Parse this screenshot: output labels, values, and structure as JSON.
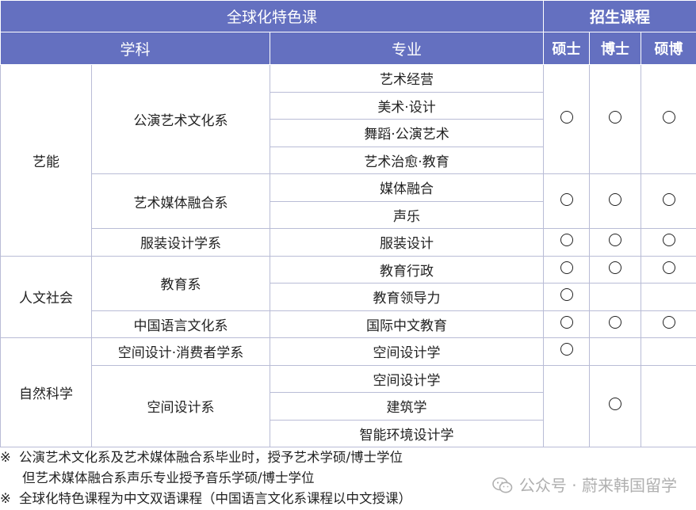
{
  "header": {
    "program_group": "全球化特色课",
    "enrollment": "招生课程",
    "col_discipline": "学科",
    "col_major": "专业",
    "col_master": "硕士",
    "col_phd": "博士",
    "col_combined": "硕博"
  },
  "disciplines": {
    "arts": "艺能",
    "humanities": "人文社会",
    "science": "自然科学"
  },
  "departments": {
    "performing_arts_culture": "公演艺术文化系",
    "art_media_convergence": "艺术媒体融合系",
    "fashion_design": "服装设计学系",
    "education": "教育系",
    "chinese_language_culture": "中国语言文化系",
    "space_design_consumer": "空间设计·消费者学系",
    "space_design": "空间设计系"
  },
  "majors": {
    "art_management": "艺术经营",
    "fine_art_design": "美术·设计",
    "dance_performing_arts": "舞蹈·公演艺术",
    "art_therapy_education": "艺术治愈·教育",
    "media_convergence": "媒体融合",
    "vocal_music": "声乐",
    "fashion_design": "服装设计",
    "education_administration": "教育行政",
    "educational_leadership": "教育领导力",
    "intl_chinese_education": "国际中文教育",
    "space_design_a": "空间设计学",
    "space_design_b": "空间设计学",
    "architecture": "建筑学",
    "smart_environment_design": "智能环境设计学"
  },
  "notes": {
    "mark": "※",
    "note1": "公演艺术文化系及艺术媒体融合系毕业时，授予艺术学硕/博士学位",
    "note2": "但艺术媒体融合系声乐专业授予音乐学硕/博士学位",
    "note3": "全球化特色课程为中文双语课程（中国语言文化系课程以中文授课）"
  },
  "watermark": {
    "icon": "wechat-icon",
    "text": "公众号 · 蔚来韩国留学"
  },
  "colors": {
    "header_bg": "#6470c0",
    "header_text": "#ffffff",
    "grid": "#b9bcd6"
  }
}
